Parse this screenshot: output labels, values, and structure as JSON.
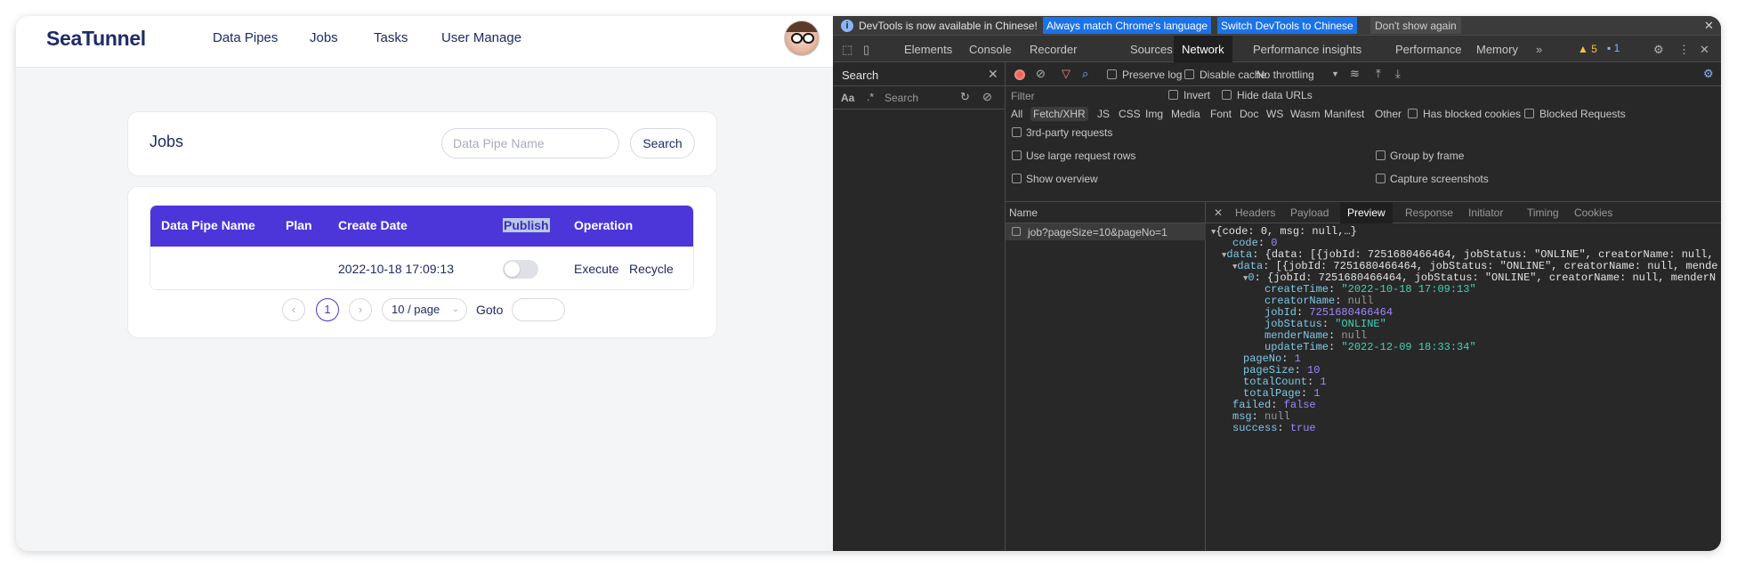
{
  "app": {
    "logo": "SeaTunnel",
    "nav": [
      "Data Pipes",
      "Jobs",
      "Tasks",
      "User Manage"
    ]
  },
  "jobs": {
    "title": "Jobs",
    "search_placeholder": "Data Pipe Name",
    "search_button": "Search",
    "columns": [
      "Data Pipe Name",
      "Plan",
      "Create Date",
      "Publish",
      "Operation"
    ],
    "rows": [
      {
        "data_pipe_name": "",
        "plan": "",
        "create_date": "2022-10-18 17:09:13",
        "publish": false,
        "ops": [
          "Execute",
          "Recycle"
        ]
      }
    ],
    "pagination": {
      "prev": "‹",
      "current": "1",
      "next": "›",
      "page_size": "10 / page",
      "goto_label": "Goto"
    }
  },
  "devtools": {
    "info_message": "DevTools is now available in Chinese!",
    "info_buttons": [
      "Always match Chrome's language",
      "Switch DevTools to Chinese"
    ],
    "dont_show": "Don't show again",
    "tabs": [
      "Elements",
      "Console",
      "Recorder",
      "Sources",
      "Network",
      "Performance insights",
      "Performance",
      "Memory"
    ],
    "active_tab": "Network",
    "warnings": "5",
    "messages": "1",
    "search_panel": {
      "title": "Search",
      "case_label": "Aa",
      "regex_label": ".*",
      "placeholder": "Search"
    },
    "network": {
      "preserve_log": "Preserve log",
      "disable_cache": "Disable cache",
      "throttling": "No throttling",
      "filter_placeholder": "Filter",
      "invert": "Invert",
      "hide_data_urls": "Hide data URLs",
      "types": [
        "All",
        "Fetch/XHR",
        "JS",
        "CSS",
        "Img",
        "Media",
        "Font",
        "Doc",
        "WS",
        "Wasm",
        "Manifest",
        "Other"
      ],
      "active_type": "Fetch/XHR",
      "has_blocked_cookies": "Has blocked cookies",
      "blocked_requests": "Blocked Requests",
      "third_party": "3rd-party requests",
      "large_rows": "Use large request rows",
      "group_by_frame": "Group by frame",
      "show_overview": "Show overview",
      "capture_screenshots": "Capture screenshots",
      "name_header": "Name",
      "request": "job?pageSize=10&pageNo=1",
      "detail_tabs": [
        "Headers",
        "Payload",
        "Preview",
        "Response",
        "Initiator",
        "Timing",
        "Cookies"
      ],
      "active_detail_tab": "Preview"
    },
    "preview": {
      "root": "{code: 0, msg: null,…}",
      "code_key": "code",
      "code_val": "0",
      "data_key": "data",
      "data_sum": "{data: [{jobId: 7251680466464, jobStatus: \"ONLINE\", creatorName: null,",
      "inner_key": "data",
      "inner_sum": "[{jobId: 7251680466464, jobStatus: \"ONLINE\", creatorName: null, mende",
      "item_key": "0",
      "item_sum": "{jobId: 7251680466464, jobStatus: \"ONLINE\", creatorName: null, menderN",
      "createTime_key": "createTime",
      "createTime_val": "\"2022-10-18 17:09:13\"",
      "creatorName_key": "creatorName",
      "creatorName_val": "null",
      "jobId_key": "jobId",
      "jobId_val": "7251680466464",
      "jobStatus_key": "jobStatus",
      "jobStatus_val": "\"ONLINE\"",
      "menderName_key": "menderName",
      "menderName_val": "null",
      "updateTime_key": "updateTime",
      "updateTime_val": "\"2022-12-09 18:33:34\"",
      "pageNo_key": "pageNo",
      "pageNo_val": "1",
      "pageSize_key": "pageSize",
      "pageSize_val": "10",
      "totalCount_key": "totalCount",
      "totalCount_val": "1",
      "totalPage_key": "totalPage",
      "totalPage_val": "1",
      "failed_key": "failed",
      "failed_val": "false",
      "msg_key": "msg",
      "msg_val": "null",
      "success_key": "success",
      "success_val": "true"
    }
  }
}
